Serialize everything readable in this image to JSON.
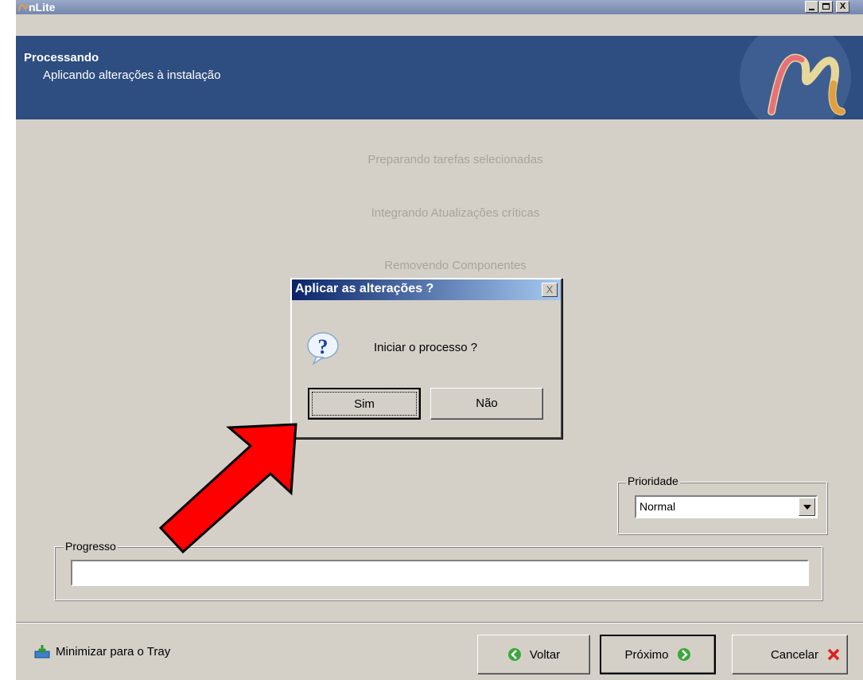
{
  "window": {
    "title": "nLite",
    "controls": {
      "minimize": "_",
      "maximize": "□",
      "close": "X"
    }
  },
  "header": {
    "title": "Processando",
    "subtitle": "Aplicando alterações à instalação"
  },
  "stages": [
    "Preparando tarefas selecionadas",
    "Integrando Atualizações críticas",
    "Removendo Componentes"
  ],
  "priority": {
    "label": "Prioridade",
    "selected": "Normal"
  },
  "progress": {
    "label": "Progresso",
    "value": 0
  },
  "footer": {
    "tray_label": "Minimizar para o Tray",
    "back_label": "Voltar",
    "next_label": "Próximo",
    "cancel_label": "Cancelar"
  },
  "dialog": {
    "title": "Aplicar as alterações ?",
    "close_label": "X",
    "message": "Iniciar o processo ?",
    "yes_label": "Sim",
    "no_label": "Não",
    "icon": "question-icon"
  },
  "colors": {
    "banner": "#2e4d80",
    "window_bg": "#d4d0c8",
    "dialog_title_start": "#0a246a",
    "dialog_title_end": "#a6caf0",
    "annotation_arrow": "#ff0000"
  }
}
